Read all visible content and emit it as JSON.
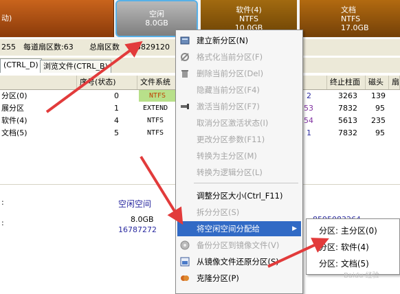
{
  "partition_bar": {
    "seg_a_label": "动)",
    "free": {
      "label": "空闲",
      "size": "8.0GB"
    },
    "seg_c": {
      "label": "软件(4)",
      "fs": "NTFS",
      "size": "10.0GB"
    },
    "seg_d": {
      "label": "文档",
      "fs": "NTFS",
      "size": "17.0GB"
    }
  },
  "info_bar": {
    "v1": "255",
    "sectors_per_track": "每道扇区数:63",
    "total_sectors": "总扇区数",
    "total_sectors_value": "5829120"
  },
  "tabs": [
    {
      "label": "(CTRL_D)"
    },
    {
      "label": "浏览文件(CTRL_B)"
    }
  ],
  "table": {
    "headers": [
      "序号(状态)",
      "文件系统",
      "终止柱面",
      "磁头",
      "扇"
    ],
    "rows": [
      {
        "name": "分区(0)",
        "index": "0",
        "fs": "NTFS",
        "c1": "2",
        "end_cyl": "3263",
        "head": "139"
      },
      {
        "name": "展分区",
        "index": "1",
        "fs": "EXTEND",
        "c1": "53",
        "end_cyl": "7832",
        "head": "95"
      },
      {
        "name": "软件(4)",
        "index": "4",
        "fs": "NTFS",
        "c1": "54",
        "end_cyl": "5613",
        "head": "235"
      },
      {
        "name": "文档(5)",
        "index": "5",
        "fs": "NTFS",
        "c1": "1",
        "end_cyl": "7832",
        "head": "95"
      }
    ]
  },
  "lower_panel": {
    "colon1": ":",
    "free_space": "空闲空间",
    "colon2": ":",
    "size": "8.0GB",
    "sectors": "16787272",
    "right_value": "8595083264"
  },
  "context_menu": {
    "items": [
      {
        "label": "建立新分区(N)",
        "icon": "new-partition-icon"
      },
      {
        "label": "格式化当前分区(F)",
        "icon": "format-icon"
      },
      {
        "label": "删除当前分区(Del)",
        "icon": "trash-icon"
      },
      {
        "label": "隐藏当前分区(F4)"
      },
      {
        "label": "激活当前分区(F7)",
        "icon": "activate-icon"
      },
      {
        "label": "取消分区激活状态(I)"
      },
      {
        "label": "更改分区参数(F11)"
      },
      {
        "label": "转换为主分区(M)"
      },
      {
        "label": "转换为逻辑分区(L)"
      },
      {
        "label": "调整分区大小(Ctrl_F11)"
      },
      {
        "label": "拆分分区(S)"
      },
      {
        "label": "将空闲空间分配给"
      },
      {
        "label": "备份分区到镜像文件(V)",
        "icon": "backup-icon"
      },
      {
        "label": "从镜像文件还原分区(S)",
        "icon": "restore-icon"
      },
      {
        "label": "克隆分区(P)",
        "icon": "clone-icon"
      }
    ]
  },
  "submenu": {
    "items": [
      {
        "label": "分区: 主分区(0)"
      },
      {
        "label": "分区: 软件(4)"
      },
      {
        "label": "分区: 文档(5)"
      }
    ]
  },
  "watermark": "Baidu 经验",
  "colors": {
    "arrow": "#e23b3b",
    "highlight": "#316ac5"
  }
}
